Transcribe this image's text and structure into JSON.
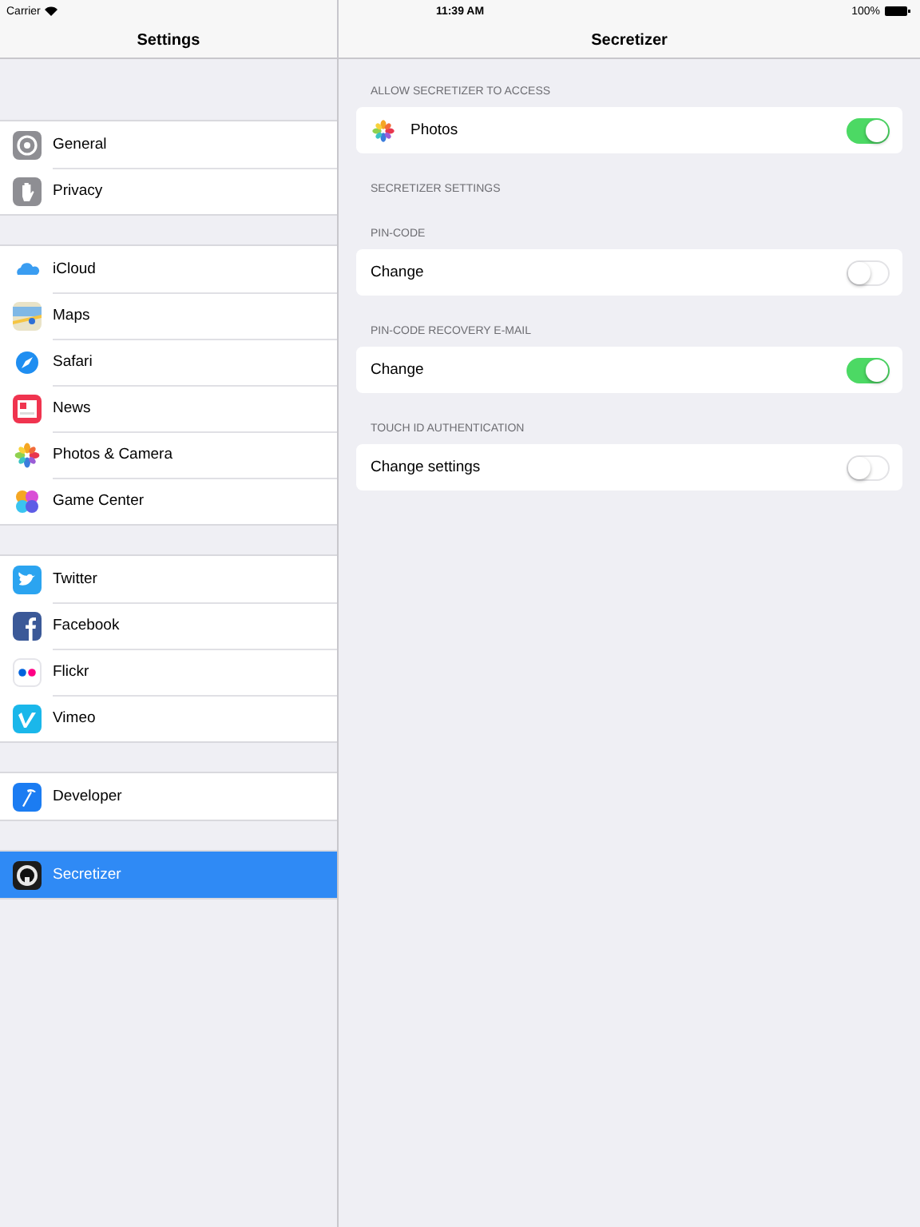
{
  "status_bar": {
    "carrier": "Carrier",
    "time": "11:39 AM",
    "battery": "100%"
  },
  "sidebar": {
    "title": "Settings",
    "groups": [
      {
        "items": [
          {
            "label": "General",
            "selected": false
          },
          {
            "label": "Privacy",
            "selected": false
          }
        ]
      },
      {
        "items": [
          {
            "label": "iCloud",
            "selected": false
          },
          {
            "label": "Maps",
            "selected": false
          },
          {
            "label": "Safari",
            "selected": false
          },
          {
            "label": "News",
            "selected": false
          },
          {
            "label": "Photos & Camera",
            "selected": false
          },
          {
            "label": "Game Center",
            "selected": false
          }
        ]
      },
      {
        "items": [
          {
            "label": "Twitter",
            "selected": false
          },
          {
            "label": "Facebook",
            "selected": false
          },
          {
            "label": "Flickr",
            "selected": false
          },
          {
            "label": "Vimeo",
            "selected": false
          }
        ]
      },
      {
        "items": [
          {
            "label": "Developer",
            "selected": false
          }
        ]
      },
      {
        "items": [
          {
            "label": "Secretizer",
            "selected": true
          }
        ]
      }
    ]
  },
  "detail": {
    "title": "Secretizer",
    "sections": [
      {
        "header": "ALLOW SECRETIZER TO ACCESS",
        "rows": [
          {
            "label": "Photos",
            "on": true
          }
        ]
      },
      {
        "header": "SECRETIZER SETTINGS"
      },
      {
        "header": "PIN-CODE",
        "rows": [
          {
            "label": "Change",
            "on": false
          }
        ]
      },
      {
        "header": "PIN-CODE RECOVERY E-MAIL",
        "rows": [
          {
            "label": "Change",
            "on": true
          }
        ]
      },
      {
        "header": "TOUCH ID AUTHENTICATION",
        "rows": [
          {
            "label": "Change settings",
            "on": false
          }
        ]
      }
    ]
  }
}
